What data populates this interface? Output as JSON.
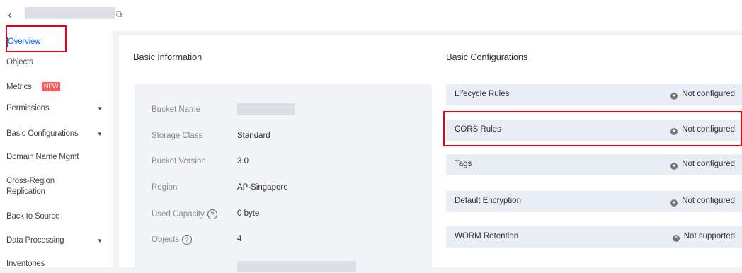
{
  "header": {
    "back_icon": "chevron-left-icon",
    "copy_icon": "copy-icon"
  },
  "sidebar": {
    "items": [
      {
        "label": "Overview",
        "active": true
      },
      {
        "label": "Objects"
      },
      {
        "label": "Metrics",
        "badge": "NEW"
      },
      {
        "label": "Permissions",
        "expandable": true
      },
      {
        "label": "Basic Configurations",
        "expandable": true
      },
      {
        "label": "Domain Name Mgmt"
      },
      {
        "label": "Cross-Region Replication"
      },
      {
        "label": "Back to Source"
      },
      {
        "label": "Data Processing",
        "expandable": true
      },
      {
        "label": "Inventories"
      }
    ]
  },
  "basic_info": {
    "title": "Basic Information",
    "rows": [
      {
        "label": "Bucket Name",
        "value": ""
      },
      {
        "label": "Storage Class",
        "value": "Standard"
      },
      {
        "label": "Bucket Version",
        "value": "3.0"
      },
      {
        "label": "Region",
        "value": "AP-Singapore"
      },
      {
        "label": "Used Capacity",
        "value": "0 byte",
        "help": "?"
      },
      {
        "label": "Objects",
        "value": "4",
        "help": "?"
      }
    ]
  },
  "basic_config": {
    "title": "Basic Configurations",
    "rows": [
      {
        "label": "Lifecycle Rules",
        "status": "Not configured"
      },
      {
        "label": "CORS Rules",
        "status": "Not configured"
      },
      {
        "label": "Tags",
        "status": "Not configured"
      },
      {
        "label": "Default Encryption",
        "status": "Not configured"
      },
      {
        "label": "WORM Retention",
        "status": "Not supported"
      }
    ]
  },
  "colors": {
    "accent": "#006eff",
    "highlight": "#e60012",
    "badge": "#ff5a5a"
  }
}
